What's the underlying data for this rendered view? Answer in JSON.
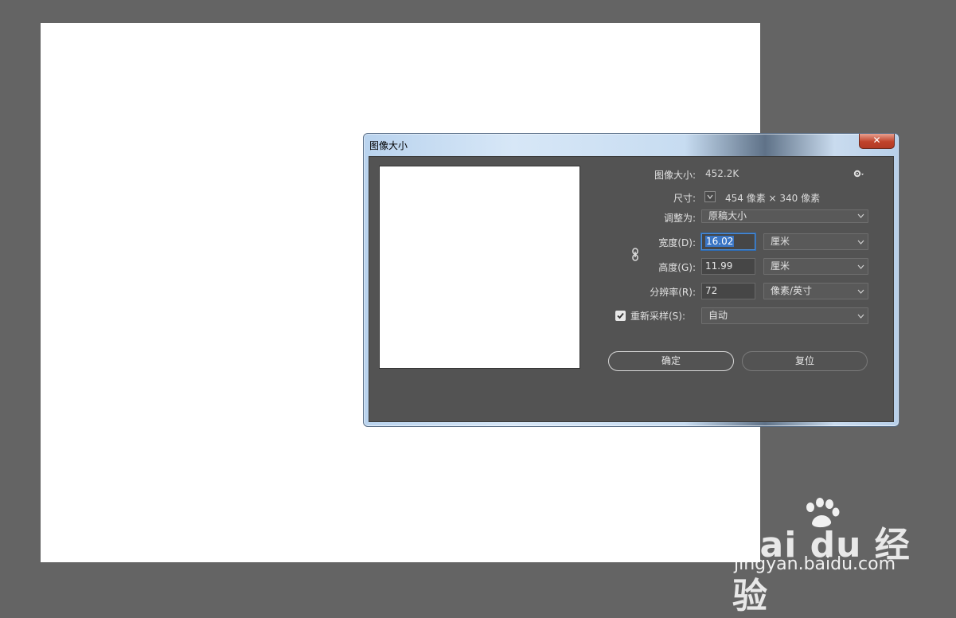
{
  "dialog": {
    "title": "图像大小",
    "close_label": "✕",
    "image_size_label": "图像大小:",
    "image_size_value": "452.2K",
    "dimensions_label": "尺寸:",
    "dimensions_value": "454 像素 × 340 像素",
    "fit_to_label": "调整为:",
    "fit_to_value": "原稿大小",
    "width_label": "宽度(D):",
    "width_value": "16.02",
    "width_unit": "厘米",
    "height_label": "高度(G):",
    "height_value": "11.99",
    "height_unit": "厘米",
    "resolution_label": "分辨率(R):",
    "resolution_value": "72",
    "resolution_unit": "像素/英寸",
    "resample_label": "重新采样(S):",
    "resample_checked": true,
    "resample_value": "自动",
    "ok_label": "确定",
    "reset_label": "复位"
  },
  "watermark": {
    "brand": "Bai du 经验",
    "url": "jingyan.baidu.com"
  },
  "icons": {
    "gear": "gear-icon",
    "chevron": "chevron-down-icon",
    "link": "link-chain-icon",
    "check": "check-icon",
    "close": "close-icon",
    "paw": "paw-icon"
  },
  "colors": {
    "workspace_bg": "#646464",
    "dialog_client_bg": "#535353",
    "close_button": "#c0432b",
    "focus_blue": "#4a8edc"
  }
}
